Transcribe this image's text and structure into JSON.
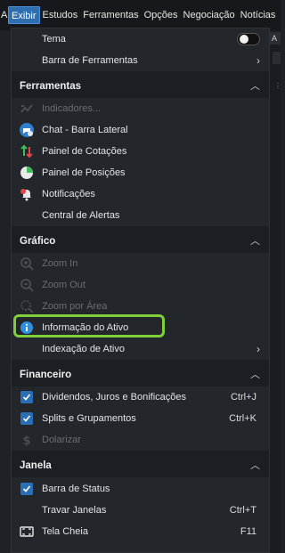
{
  "menubar": {
    "edge_label": "A",
    "items": [
      "Exibir",
      "Estudos",
      "Ferramentas",
      "Opções",
      "Negociação",
      "Notícias"
    ]
  },
  "background_app": {
    "tab_label": "A"
  },
  "menu": {
    "top_items": [
      {
        "label": "Tema"
      },
      {
        "label": "Barra de Ferramentas"
      }
    ],
    "sections": [
      {
        "title": "Ferramentas",
        "items": [
          {
            "label": "Indicadores...",
            "disabled": true,
            "icon": "indicator-icon"
          },
          {
            "label": "Chat - Barra Lateral",
            "icon": "chat-icon"
          },
          {
            "label": "Painel de Cotações",
            "icon": "quotes-arrows-icon"
          },
          {
            "label": "Painel de Posições",
            "icon": "pie-chart-icon"
          },
          {
            "label": "Notificações",
            "icon": "bell-icon"
          },
          {
            "label": "Central de Alertas",
            "icon": ""
          }
        ]
      },
      {
        "title": "Gráfico",
        "items": [
          {
            "label": "Zoom In",
            "disabled": true,
            "icon": "zoom-in-icon"
          },
          {
            "label": "Zoom Out",
            "disabled": true,
            "icon": "zoom-out-icon"
          },
          {
            "label": "Zoom por Área",
            "disabled": true,
            "icon": "zoom-area-icon"
          },
          {
            "label": "Informação do Ativo",
            "icon": "info-icon"
          },
          {
            "label": "Indexação de Ativo",
            "icon": ""
          }
        ]
      },
      {
        "title": "Financeiro",
        "items": [
          {
            "label": "Dividendos, Juros e Bonificações",
            "shortcut": "Ctrl+J",
            "checked": true
          },
          {
            "label": "Splits e Grupamentos",
            "shortcut": "Ctrl+K",
            "checked": true
          },
          {
            "label": "Dolarizar",
            "disabled": true,
            "icon": "dollar-icon"
          }
        ]
      },
      {
        "title": "Janela",
        "items": [
          {
            "label": "Barra de Status",
            "checked": true
          },
          {
            "label": "Travar Janelas",
            "shortcut": "Ctrl+T"
          },
          {
            "label": "Tela Cheia",
            "shortcut": "F11",
            "icon": "fullscreen-icon"
          }
        ]
      }
    ]
  },
  "colors": {
    "accent": "#2f6fb0",
    "highlight_border": "#7ecf3a",
    "menu_bg": "#23272c",
    "section_bg": "#1b1e22"
  }
}
